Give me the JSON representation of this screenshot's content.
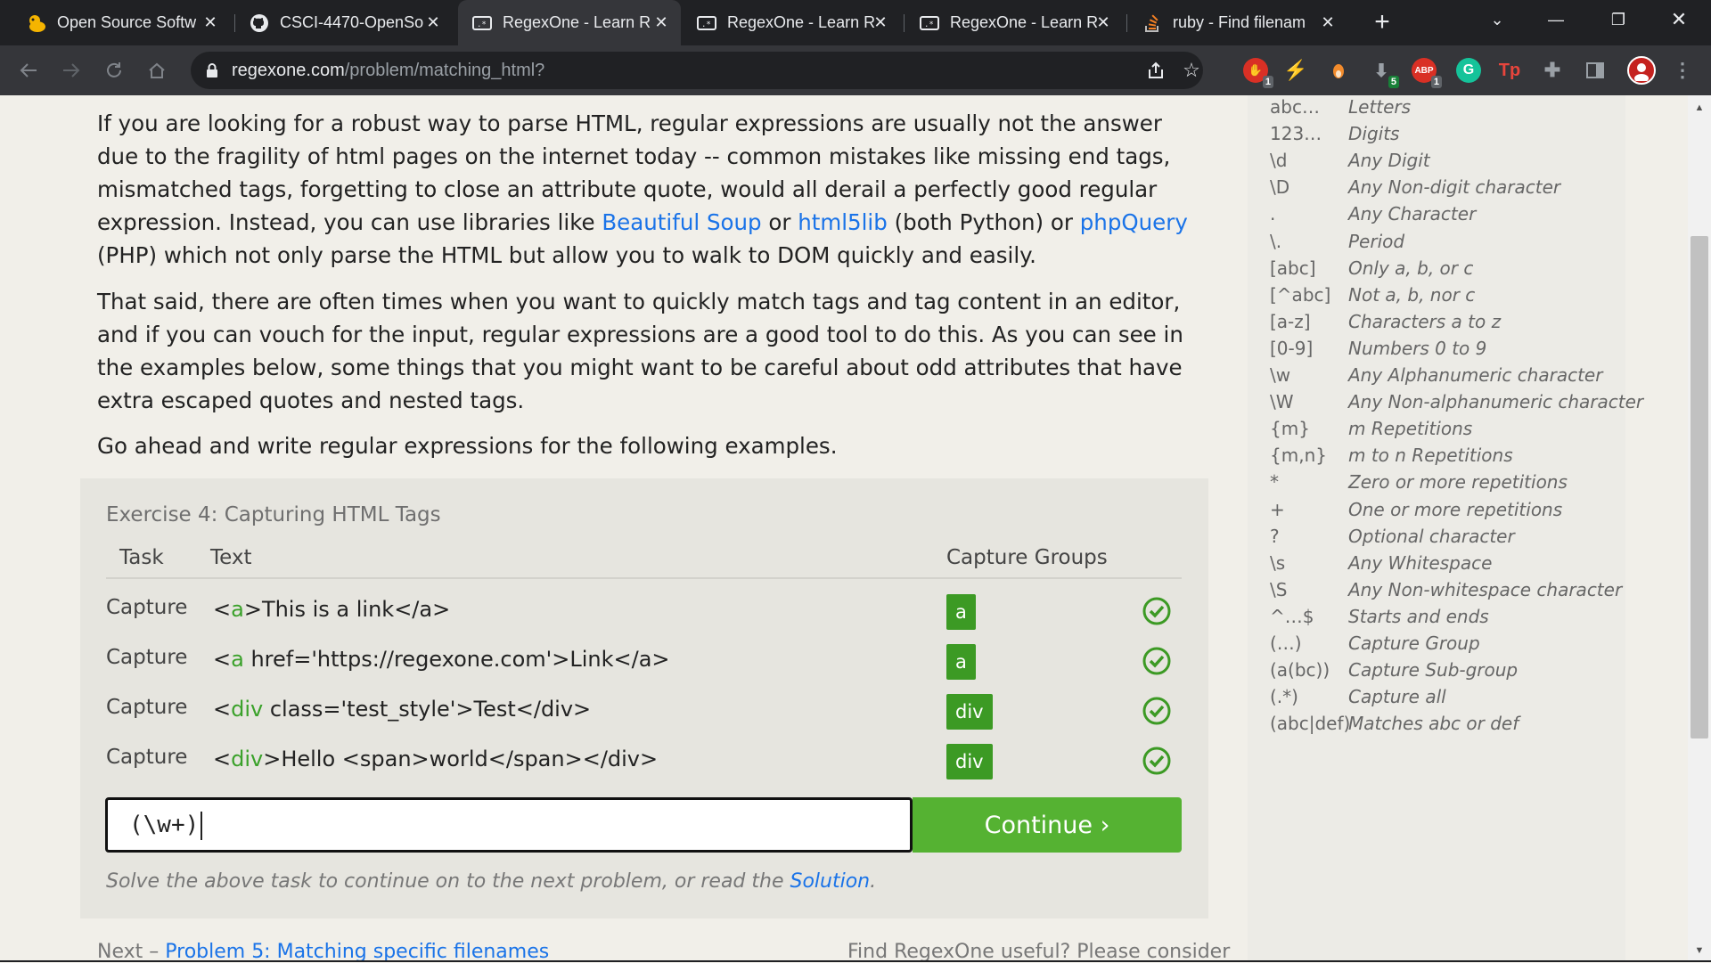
{
  "browser": {
    "tabs": [
      {
        "title": "Open Source Softw",
        "icon": "duck-icon"
      },
      {
        "title": "CSCI-4470-OpenSo",
        "icon": "github-icon"
      },
      {
        "title": "RegexOne - Learn R",
        "icon": "regexone-icon",
        "active": true
      },
      {
        "title": "RegexOne - Learn R",
        "icon": "regexone-icon"
      },
      {
        "title": "RegexOne - Learn R",
        "icon": "regexone-icon"
      },
      {
        "title": "ruby - Find filenam",
        "icon": "stackoverflow-icon"
      }
    ],
    "url_domain": "regexone.com",
    "url_path": "/problem/matching_html?",
    "extensions": [
      {
        "name": "shield-extension-icon",
        "badge": "1",
        "color": "#d93025"
      },
      {
        "name": "lightning-extension-icon",
        "badge": "",
        "color": "#c9a400"
      },
      {
        "name": "fox-extension-icon",
        "badge": "",
        "color": "#f28b2c"
      },
      {
        "name": "download-extension-icon",
        "badge": "5",
        "color": "#5f6368"
      },
      {
        "name": "adblock-extension-icon",
        "badge": "1",
        "color": "#d93025",
        "label": "ABP"
      },
      {
        "name": "grammarly-extension-icon",
        "badge": "",
        "color": "#15c39a",
        "label": "G"
      },
      {
        "name": "tp-extension-icon",
        "badge": "",
        "color": "#e8453c",
        "label": "Tp"
      },
      {
        "name": "puzzle-extensions-icon",
        "badge": "",
        "color": "#9aa0a6"
      },
      {
        "name": "sidepanel-icon",
        "badge": "",
        "color": "#9aa0a6"
      }
    ]
  },
  "content": {
    "para1_a": "If you are looking for a robust way to parse HTML, regular expressions are usually not the answer due to the fragility of html pages on the internet today -- common mistakes like missing end tags, mismatched tags, forgetting to close an attribute quote, would all derail a perfectly good regular expression. Instead, you can use libraries like ",
    "link_bs": "Beautiful Soup",
    "para1_b": " or ",
    "link_h5": "html5lib",
    "para1_c": " (both Python) or ",
    "link_pq": "phpQuery",
    "para1_d": " (PHP) which not only parse the HTML but allow you to walk to DOM quickly and easily.",
    "para2": "That said, there are often times when you want to quickly match tags and tag content in an editor, and if you can vouch for the input, regular expressions are a good tool to do this. As you can see in the examples below, some things that you might want to be careful about odd attributes that have extra escaped quotes and nested tags.",
    "para3": "Go ahead and write regular expressions for the following examples."
  },
  "exercise": {
    "title": "Exercise 4: Capturing HTML Tags",
    "col_task": "Task",
    "col_text": "Text",
    "col_groups": "Capture Groups",
    "rows": [
      {
        "task": "Capture",
        "pre": "<",
        "hl": "a",
        "post": ">This is a link</a>",
        "group": "a"
      },
      {
        "task": "Capture",
        "pre": "<",
        "hl": "a",
        "post": " href='https://regexone.com'>Link</a>",
        "group": "a"
      },
      {
        "task": "Capture",
        "pre": "<",
        "hl": "div",
        "post": " class='test_style'>Test</div>",
        "group": "div"
      },
      {
        "task": "Capture",
        "pre": "<",
        "hl": "div",
        "post": ">Hello <span>world</span></div>",
        "group": "div"
      }
    ],
    "answer_value": "(\\w+)",
    "continue_label": "Continue ›",
    "solve_text": "Solve the above task to continue on to the next problem, or read the ",
    "solution_link": "Solution",
    "solve_end": ".",
    "next_prefix": "Next – ",
    "next_link": "Problem 5: Matching specific filenames",
    "consider_text": "Find RegexOne useful? Please consider"
  },
  "cheatsheet": [
    {
      "sym": "abc…",
      "desc": "Letters"
    },
    {
      "sym": "123…",
      "desc": "Digits"
    },
    {
      "sym": "\\d",
      "desc": "Any Digit"
    },
    {
      "sym": "\\D",
      "desc": "Any Non-digit character"
    },
    {
      "sym": ".",
      "desc": "Any Character"
    },
    {
      "sym": "\\.",
      "desc": "Period"
    },
    {
      "sym": "[abc]",
      "desc": "Only a, b, or c"
    },
    {
      "sym": "[^abc]",
      "desc": "Not a, b, nor c"
    },
    {
      "sym": "[a-z]",
      "desc": "Characters a to z"
    },
    {
      "sym": "[0-9]",
      "desc": "Numbers 0 to 9"
    },
    {
      "sym": "\\w",
      "desc": "Any Alphanumeric character"
    },
    {
      "sym": "\\W",
      "desc": "Any Non-alphanumeric character"
    },
    {
      "sym": "{m}",
      "desc": "m Repetitions"
    },
    {
      "sym": "{m,n}",
      "desc": "m to n Repetitions"
    },
    {
      "sym": "*",
      "desc": "Zero or more repetitions"
    },
    {
      "sym": "+",
      "desc": "One or more repetitions"
    },
    {
      "sym": "?",
      "desc": "Optional character"
    },
    {
      "sym": "\\s",
      "desc": "Any Whitespace"
    },
    {
      "sym": "\\S",
      "desc": "Any Non-whitespace character"
    },
    {
      "sym": "^…$",
      "desc": "Starts and ends"
    },
    {
      "sym": "(…)",
      "desc": "Capture Group"
    },
    {
      "sym": "(a(bc))",
      "desc": "Capture Sub-group"
    },
    {
      "sym": "(.*)",
      "desc": "Capture all"
    },
    {
      "sym": "(abc|def)",
      "desc": "Matches abc or def"
    }
  ],
  "colors": {
    "accent_green": "#55b232",
    "badge_green": "#3c9a24",
    "link_blue": "#1a73e8"
  }
}
